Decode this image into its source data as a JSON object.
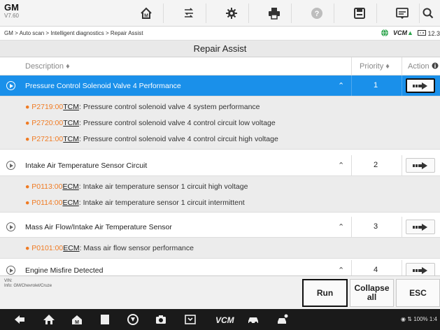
{
  "header": {
    "make": "GM",
    "version": "V7.60",
    "toolbar": [
      {
        "name": "home-icon"
      },
      {
        "name": "vehicle-swap-icon"
      },
      {
        "name": "settings-icon"
      },
      {
        "name": "print-icon"
      },
      {
        "name": "help-icon"
      },
      {
        "name": "save-icon"
      },
      {
        "name": "data-log-icon"
      },
      {
        "name": "search-icon"
      }
    ]
  },
  "breadcrumb": "GM > Auto scan > Intelligent diagnostics > Repair Assist",
  "status_right": {
    "vcm_text": "VCM",
    "battery_text": "12.3"
  },
  "page_title": "Repair Assist",
  "table": {
    "col_description": "Description ♦",
    "col_priority": "Priority ♦",
    "col_action": "Action",
    "groups": [
      {
        "title": "Pressure Control Solenoid Valve 4 Performance",
        "priority": "1",
        "selected": true,
        "codes": [
          {
            "dtc": "P2719:00",
            "module": "TCM",
            "text": ": Pressure control solenoid valve 4 system performance"
          },
          {
            "dtc": "P2720:00",
            "module": "TCM",
            "text": ": Pressure control solenoid valve 4 control circuit low voltage"
          },
          {
            "dtc": "P2721:00",
            "module": "TCM",
            "text": ": Pressure control solenoid valve 4 control circuit high voltage"
          }
        ]
      },
      {
        "title": "Intake Air Temperature Sensor Circuit",
        "priority": "2",
        "selected": false,
        "codes": [
          {
            "dtc": "P0113:00",
            "module": "ECM",
            "text": ": Intake air temperature sensor 1 circuit high voltage"
          },
          {
            "dtc": "P0114:00",
            "module": "ECM",
            "text": ": Intake air temperature sensor 1 circuit intermittent"
          }
        ]
      },
      {
        "title": "Mass Air Flow/Intake Air Temperature Sensor",
        "priority": "3",
        "selected": false,
        "codes": [
          {
            "dtc": "P0101:00",
            "module": "ECM",
            "text": ": Mass air flow sensor performance"
          }
        ]
      },
      {
        "title": "Engine Misfire Detected",
        "priority": "4",
        "selected": false,
        "codes": []
      }
    ]
  },
  "bottom": {
    "vin_label": "VIN:",
    "info_label": "Info: GM/Chevrolet/Cruze",
    "run_label": "Run",
    "collapse_label": "Collapse all",
    "esc_label": "ESC"
  },
  "system": {
    "status_text": "100% 1:4"
  },
  "colors": {
    "selected_row": "#1a90ea",
    "dtc_orange": "#f07b23",
    "vcm_green": "#2aa34a"
  }
}
